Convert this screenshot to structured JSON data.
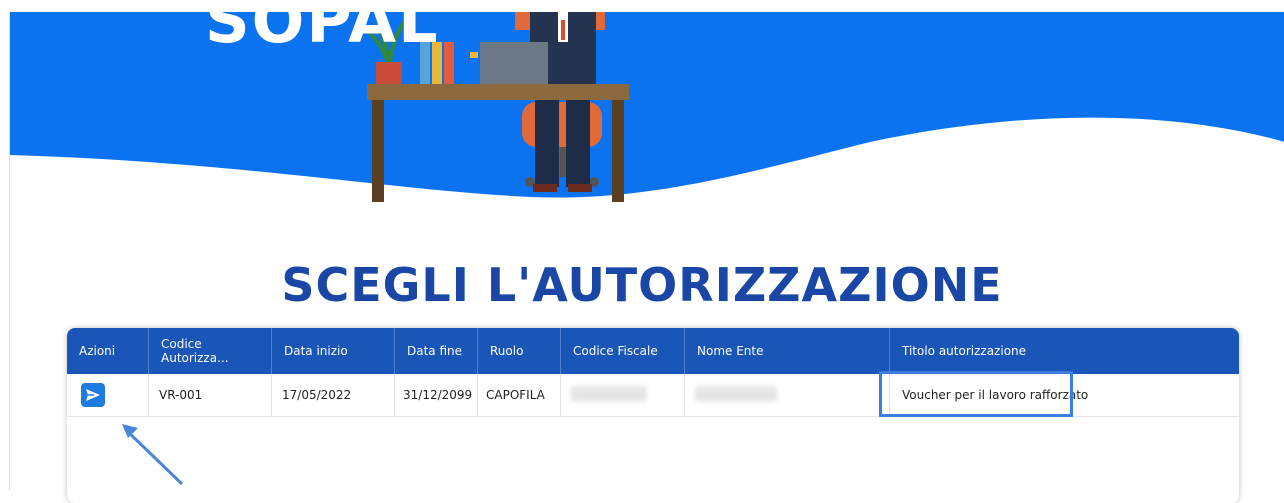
{
  "brand": {
    "text": "SOPAL"
  },
  "page_title": "SCEGLI L'AUTORIZZAZIONE",
  "colors": {
    "hero_blue": "#0b73f0",
    "title_blue": "#1a47a6",
    "header_blue": "#1a56b8",
    "action_blue": "#1e7be0"
  },
  "table": {
    "headers": [
      "Azioni",
      "Codice Autorizza...",
      "Data inizio",
      "Data fine",
      "Ruolo",
      "Codice Fiscale",
      "Nome Ente",
      "Titolo autorizzazione"
    ],
    "rows": [
      {
        "action_icon": "send-icon",
        "codice": "VR-001",
        "data_inizio": "17/05/2022",
        "data_fine": "31/12/2099",
        "ruolo": "CAPOFILA",
        "codice_fiscale": "",
        "nome_ente": "",
        "titolo": "Voucher per il lavoro rafforzato"
      }
    ]
  }
}
